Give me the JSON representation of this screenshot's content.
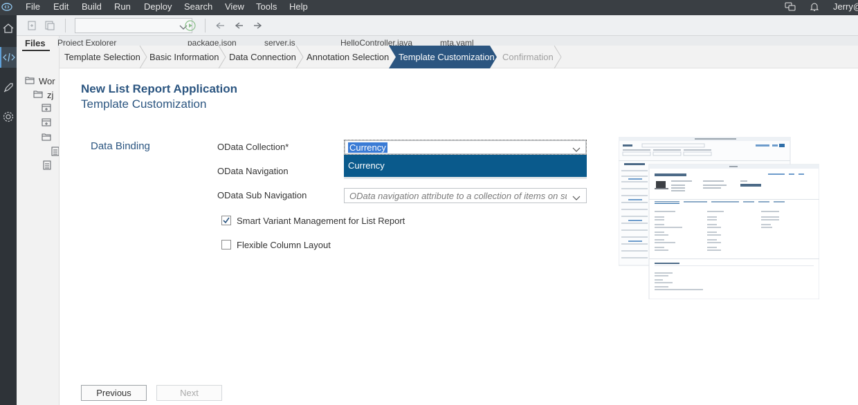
{
  "menubar": {
    "items": [
      "File",
      "Edit",
      "Build",
      "Run",
      "Deploy",
      "Search",
      "View",
      "Tools",
      "Help"
    ],
    "user": "Jerry@"
  },
  "explorer": {
    "tab_files": "Files",
    "tab_project_explorer": "Project Explorer",
    "tree": {
      "workspace": "Wor",
      "project": "zj"
    }
  },
  "editor_tabs": [
    "package.json",
    "server.js",
    "HelloController.java",
    "mta.yaml"
  ],
  "wizard": {
    "steps": [
      {
        "label": "Template Selection",
        "state": "done"
      },
      {
        "label": "Basic Information",
        "state": "done"
      },
      {
        "label": "Data Connection",
        "state": "done"
      },
      {
        "label": "Annotation Selection",
        "state": "done"
      },
      {
        "label": "Template Customization",
        "state": "active"
      },
      {
        "label": "Confirmation",
        "state": "disabled"
      }
    ],
    "title": "New List Report Application",
    "subtitle": "Template Customization",
    "section": "Data Binding",
    "fields": {
      "collection_label": "OData Collection*",
      "collection_value": "Currency",
      "collection_option": "Currency",
      "navigation_label": "OData Navigation",
      "subnav_label": "OData Sub Navigation",
      "subnav_placeholder": "OData navigation attribute to a collection of items on sub level"
    },
    "options": {
      "smart_variant_label": "Smart Variant Management for List Report",
      "smart_variant_checked": true,
      "flexible_layout_label": "Flexible Column Layout",
      "flexible_layout_checked": false
    },
    "buttons": {
      "previous": "Previous",
      "next": "Next"
    }
  },
  "colors": {
    "menubar_bg": "#3a3f44",
    "active_step": "#2b5580",
    "dropdown_selected": "#0a5a8c",
    "title_text": "#2b5580"
  }
}
